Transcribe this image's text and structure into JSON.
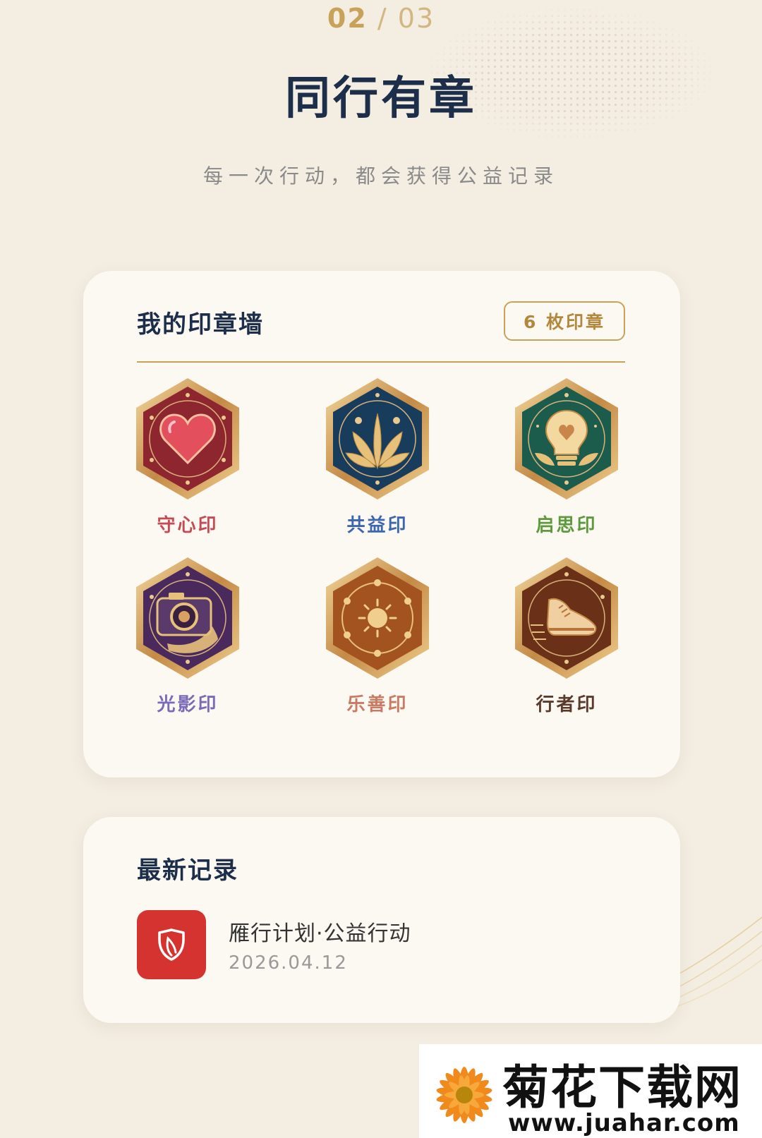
{
  "pager": {
    "current": "02",
    "separator": "/",
    "total": "03"
  },
  "title": "同行有章",
  "subtitle": "每一次行动，都会获得公益记录",
  "wall": {
    "title": "我的印章墙",
    "count_badge": "6 枚印章",
    "stamps": [
      {
        "label": "守心印",
        "color": "#c44a55",
        "base": "#8e2630",
        "icon": "heart-icon"
      },
      {
        "label": "共益印",
        "color": "#3d66b0",
        "base": "#173c5c",
        "icon": "leaf-icon"
      },
      {
        "label": "启思印",
        "color": "#5d9a3e",
        "base": "#1c5c4c",
        "icon": "lightbulb-icon"
      },
      {
        "label": "光影印",
        "color": "#7a6ab8",
        "base": "#4a2a5c",
        "icon": "camera-icon"
      },
      {
        "label": "乐善印",
        "color": "#c87a62",
        "base": "#a3531f",
        "icon": "sun-icon"
      },
      {
        "label": "行者印",
        "color": "#5a3a2a",
        "base": "#6a3018",
        "icon": "shoe-icon"
      }
    ]
  },
  "recent": {
    "title": "最新记录",
    "items": [
      {
        "title": "雁行计划·公益行动",
        "date": "2026.04.12",
        "icon": "shield-icon",
        "icon_bg": "#d5332f"
      }
    ]
  },
  "watermark": {
    "name": "菊花下载网",
    "url": "www.juahar.com"
  }
}
